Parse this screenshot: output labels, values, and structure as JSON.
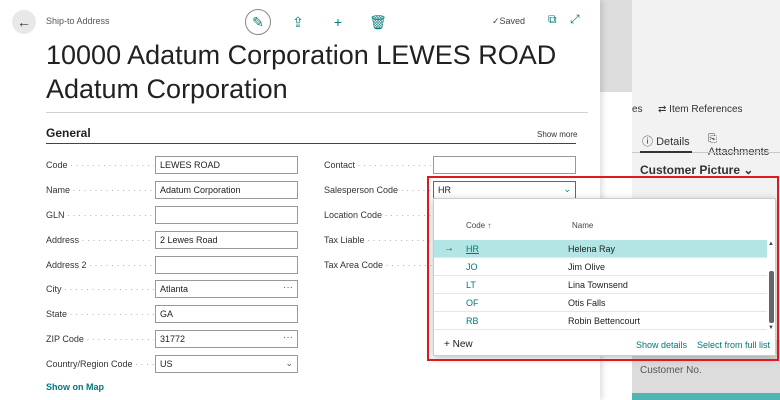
{
  "background": {
    "item_references_prefix": "es",
    "item_references": "Item References",
    "details_tab": "Details",
    "attachments_tab": "Attachments",
    "customer_picture": "Customer Picture",
    "customer_no": "Customer No."
  },
  "header": {
    "breadcrumb": "Ship-to Address",
    "saved": "Saved",
    "title": "10000 Adatum Corporation LEWES ROAD Adatum Corporation"
  },
  "general": {
    "heading": "General",
    "show_more": "Show more",
    "fields": [
      {
        "label": "Code",
        "value": "LEWES ROAD"
      },
      {
        "label": "Name",
        "value": "Adatum Corporation"
      },
      {
        "label": "GLN",
        "value": ""
      },
      {
        "label": "Address",
        "value": "2 Lewes Road"
      },
      {
        "label": "Address 2",
        "value": ""
      },
      {
        "label": "City",
        "value": "Atlanta"
      },
      {
        "label": "State",
        "value": "GA"
      },
      {
        "label": "ZIP Code",
        "value": "31772"
      },
      {
        "label": "Country/Region Code",
        "value": "US"
      }
    ],
    "right_fields": [
      {
        "label": "Contact",
        "value": ""
      },
      {
        "label": "Salesperson Code",
        "value": "HR"
      },
      {
        "label": "Location Code",
        "value": ""
      },
      {
        "label": "Tax Liable",
        "value": ""
      },
      {
        "label": "Tax Area Code",
        "value": ""
      }
    ],
    "show_on_map": "Show on Map"
  },
  "dropdown": {
    "col_code": "Code ↑",
    "col_name": "Name",
    "rows": [
      {
        "code": "HR",
        "name": "Helena Ray",
        "selected": true
      },
      {
        "code": "JO",
        "name": "Jim Olive",
        "selected": false
      },
      {
        "code": "LT",
        "name": "Lina Townsend",
        "selected": false
      },
      {
        "code": "OF",
        "name": "Otis Falls",
        "selected": false
      },
      {
        "code": "RB",
        "name": "Robin Bettencourt",
        "selected": false
      }
    ],
    "new_label": "New",
    "show_details": "Show details",
    "select_full_list": "Select from full list"
  },
  "colors": {
    "accent": "#007a7a",
    "selected_row": "#b2e5e4",
    "highlight": "#e0191f"
  }
}
